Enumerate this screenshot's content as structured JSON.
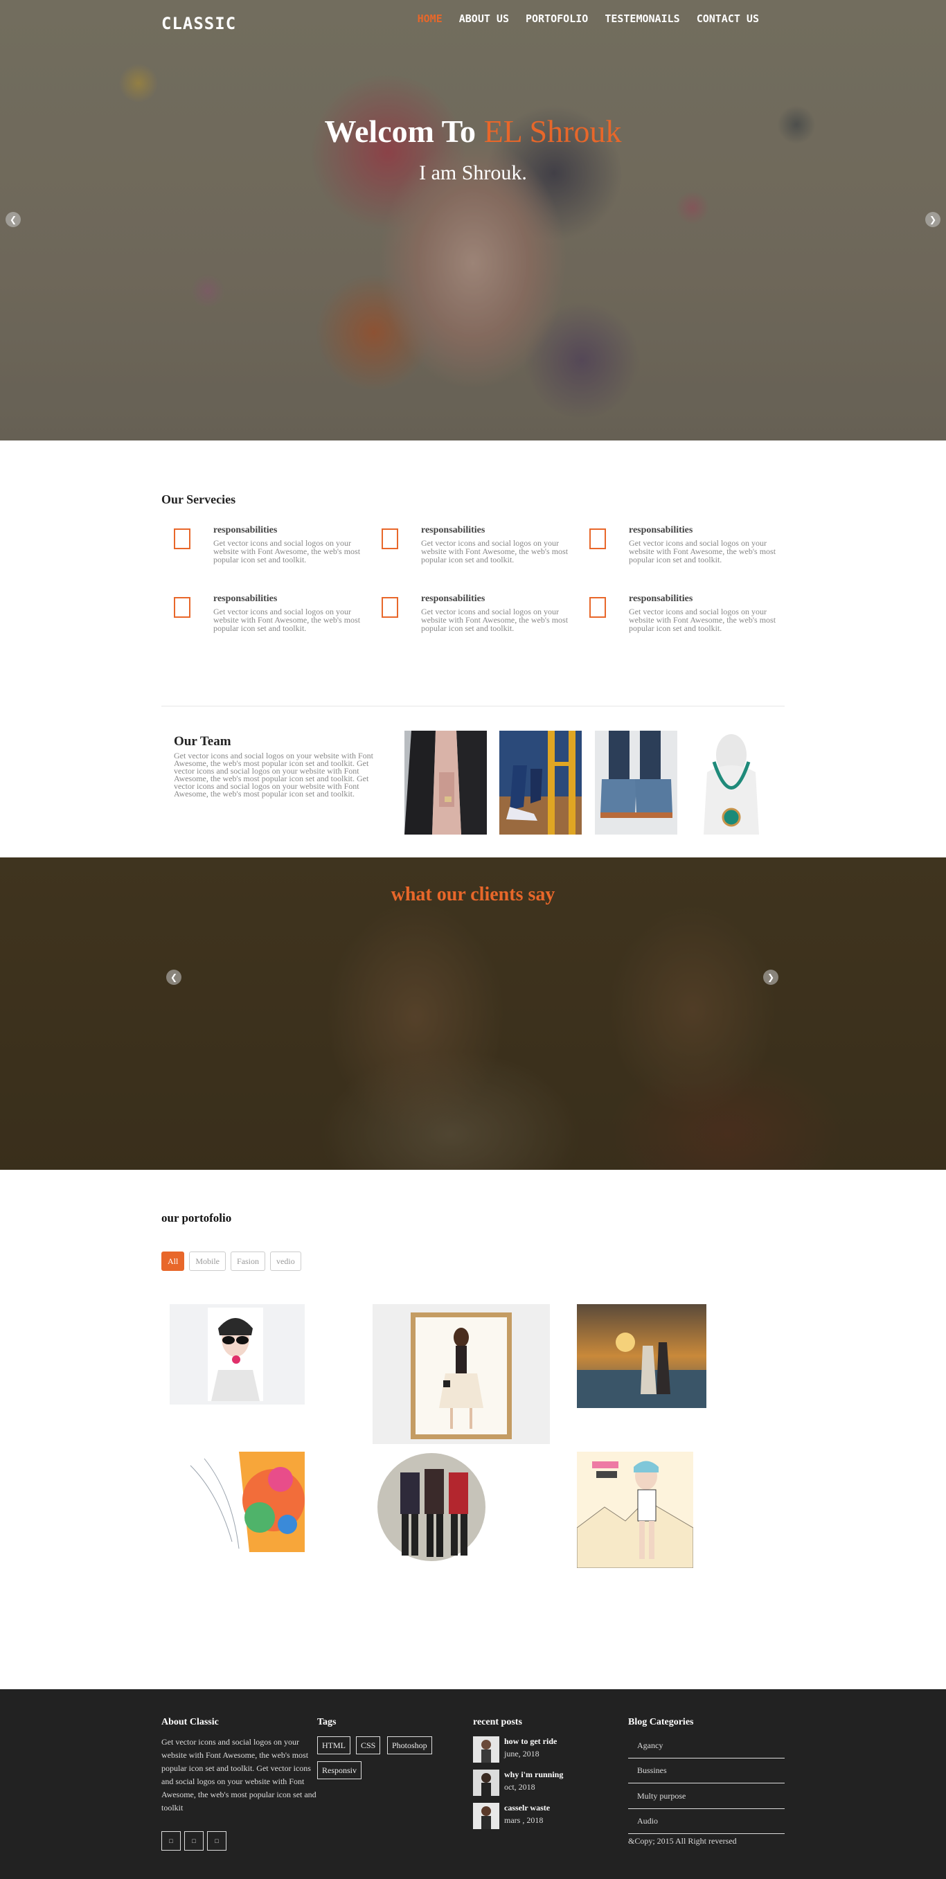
{
  "nav": {
    "logo": "CLASSIC",
    "links": [
      {
        "label": "HOME",
        "active": true
      },
      {
        "label": "ABOUT US"
      },
      {
        "label": "PORTOFOLIO"
      },
      {
        "label": "TESTEMONAILS"
      },
      {
        "label": "CONTACT US"
      }
    ]
  },
  "hero": {
    "title_prefix": "Welcom To",
    "title_accent": "EL Shrouk",
    "subtitle": "I am Shrouk.",
    "prev_icon": "chevron-left-icon",
    "next_icon": "chevron-right-icon"
  },
  "services": {
    "title": "Our Servecies",
    "items": [
      {
        "heading": "responsabilities",
        "text": "Get vector icons and social logos on your website with Font Awesome, the web's most popular icon set and toolkit."
      },
      {
        "heading": "responsabilities",
        "text": "Get vector icons and social logos on your website with Font Awesome, the web's most popular icon set and toolkit."
      },
      {
        "heading": "responsabilities",
        "text": "Get vector icons and social logos on your website with Font Awesome, the web's most popular icon set and toolkit."
      },
      {
        "heading": "responsabilities",
        "text": "Get vector icons and social logos on your website with Font Awesome, the web's most popular icon set and toolkit."
      },
      {
        "heading": "responsabilities",
        "text": "Get vector icons and social logos on your website with Font Awesome, the web's most popular icon set and toolkit."
      },
      {
        "heading": "responsabilities",
        "text": "Get vector icons and social logos on your website with Font Awesome, the web's most popular icon set and toolkit."
      }
    ]
  },
  "team": {
    "title": "Our Team",
    "text": "Get vector icons and social logos on your website with Font Awesome, the web's most popular icon set and toolkit. Get vector icons and social logos on your website with Font Awesome, the web's most popular icon set and toolkit. Get vector icons and social logos on your website with Font Awesome, the web's most popular icon set and toolkit."
  },
  "testimonials": {
    "title": "what our clients say"
  },
  "portfolio": {
    "title": "our portofolio",
    "filters": [
      {
        "label": "All",
        "active": true
      },
      {
        "label": "Mobile"
      },
      {
        "label": "Fasion"
      },
      {
        "label": "vedio"
      }
    ]
  },
  "footer": {
    "about_title": "About Classic",
    "about_text": "Get vector icons and social logos on your website with Font Awesome, the web's most popular icon set and toolkit. Get vector icons and social logos on your website with Font Awesome, the web's most popular icon set and toolkit",
    "social_icons": [
      "facebook-icon",
      "twitter-icon",
      "google-plus-icon"
    ],
    "tags_title": "Tags",
    "tags": [
      "HTML",
      "CSS",
      "Photoshop",
      "Responsiv"
    ],
    "posts_title": "recent posts",
    "posts": [
      {
        "title": "how to get ride",
        "date": "june, 2018"
      },
      {
        "title": "why i'm running",
        "date": "oct, 2018"
      },
      {
        "title": "casselr waste",
        "date": "mars , 2018"
      }
    ],
    "categories_title": "Blog Categories",
    "categories": [
      "Agancy",
      "Bussines",
      "Multy purpose",
      "Audio"
    ],
    "copyright": "&Copy; 2015 All Right reversed"
  },
  "colors": {
    "accent": "#e8672a",
    "footer_bg": "#222222"
  }
}
